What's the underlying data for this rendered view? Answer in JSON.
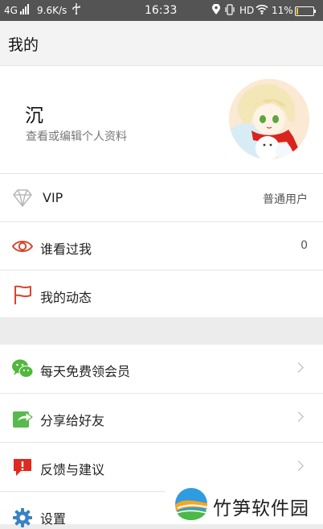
{
  "status_bar": {
    "network": "4G",
    "speed": "9.6K/s",
    "time": "16:33",
    "hd": "HD",
    "battery_percent": "11%",
    "battery_level": 0.11,
    "icons": [
      "signal-icon",
      "usb-icon",
      "location-icon",
      "vibrate-icon",
      "wifi-icon",
      "battery-icon"
    ]
  },
  "header": {
    "title": "我的"
  },
  "profile": {
    "name": "沉",
    "subtitle": "查看或编辑个人资料",
    "avatar_icon": "avatar-image"
  },
  "menu": {
    "vip": {
      "label": "VIP",
      "value": "普通用户",
      "icon": "diamond-icon"
    },
    "visitors": {
      "label": "谁看过我",
      "value": "0",
      "icon": "eye-icon"
    },
    "moments": {
      "label": "我的动态",
      "icon": "flag-icon"
    },
    "free_vip": {
      "label": "每天免费领会员",
      "icon": "wechat-icon"
    },
    "share": {
      "label": "分享给好友",
      "icon": "share-icon"
    },
    "feedback": {
      "label": "反馈与建议",
      "icon": "feedback-icon"
    },
    "settings": {
      "label": "设置",
      "icon": "gear-icon"
    }
  },
  "watermark": {
    "text": "竹笋软件园"
  },
  "colors": {
    "status_bar": "#545454",
    "eye_red": "#d8452e",
    "flag_red": "#d8452e",
    "wechat_green": "#51b83c",
    "share_green": "#58b94c",
    "feedback_red": "#e02a20",
    "gear_blue": "#3a82c4"
  }
}
